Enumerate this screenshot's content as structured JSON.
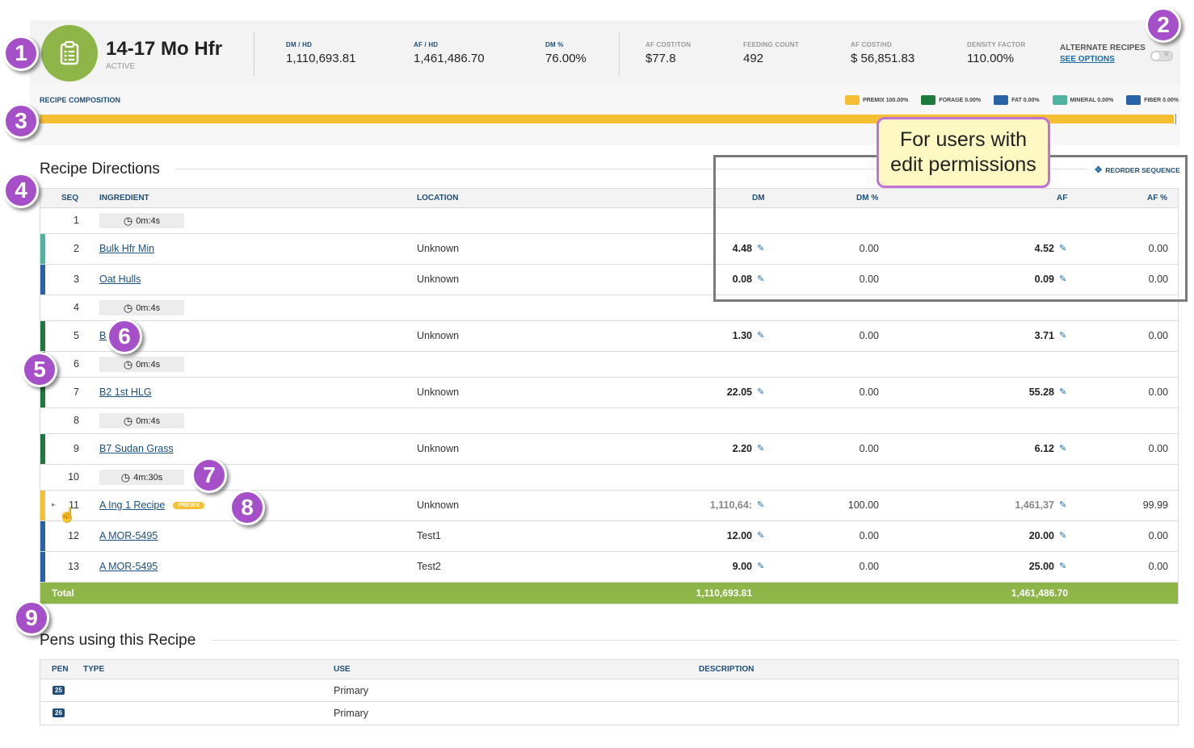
{
  "header": {
    "name": "14-17 Mo Hfr",
    "status": "ACTIVE",
    "stats": [
      {
        "label": "DM / HD",
        "value": "1,110,693.81"
      },
      {
        "label": "AF / HD",
        "value": "1,461,486.70"
      },
      {
        "label": "DM %",
        "value": "76.00%"
      },
      {
        "label": "AF COST/TON",
        "value": "$77.8"
      },
      {
        "label": "FEEDING COUNT",
        "value": "492"
      },
      {
        "label": "AF COST/HD",
        "value": "$ 56,851.83"
      },
      {
        "label": "DENSITY FACTOR",
        "value": "110.00%"
      }
    ],
    "alternate_label": "ALTERNATE RECIPES",
    "see_options": "SEE OPTIONS",
    "toggle_text": "N",
    "toggle_on": false
  },
  "composition": {
    "title": "RECIPE COMPOSITION",
    "legend": [
      {
        "label": "PREMIX 100.00%",
        "color": "#f5bf33"
      },
      {
        "label": "FORAGE 0.00%",
        "color": "#1d7a3c"
      },
      {
        "label": "FAT 0.00%",
        "color": "#2a62a8"
      },
      {
        "label": "MINERAL 0.00%",
        "color": "#4fb3a0"
      },
      {
        "label": "FIBER 0.00%",
        "color": "#2a62a8"
      }
    ],
    "premix_fraction": 1.0
  },
  "directions": {
    "title": "Recipe Directions",
    "reorder": "REORDER SEQUENCE",
    "columns": {
      "seq": "SEQ",
      "ingredient": "INGREDIENT",
      "location": "LOCATION",
      "dm": "DM",
      "dm_pct": "DM %",
      "af": "AF",
      "af_pct": "AF %"
    },
    "rows": [
      {
        "seq": "1",
        "timer": "0m:4s"
      },
      {
        "seq": "2",
        "ingredient": "Bulk Hfr Min",
        "location": "Unknown",
        "dm": "4.48",
        "dm_pct": "0.00",
        "af": "4.52",
        "af_pct": "0.00"
      },
      {
        "seq": "3",
        "ingredient": "Oat Hulls",
        "location": "Unknown",
        "dm": "0.08",
        "dm_pct": "0.00",
        "af": "0.09",
        "af_pct": "0.00"
      },
      {
        "seq": "4",
        "timer": "0m:4s"
      },
      {
        "seq": "5",
        "ingredient": "B(",
        "location": "Unknown",
        "dm": "1.30",
        "dm_pct": "0.00",
        "af": "3.71",
        "af_pct": "0.00"
      },
      {
        "seq": "6",
        "timer": "0m:4s"
      },
      {
        "seq": "7",
        "ingredient": "B2 1st HLG",
        "location": "Unknown",
        "dm": "22.05",
        "dm_pct": "0.00",
        "af": "55.28",
        "af_pct": "0.00"
      },
      {
        "seq": "8",
        "timer": "0m:4s"
      },
      {
        "seq": "9",
        "ingredient": "B7 Sudan Grass",
        "location": "Unknown",
        "dm": "2.20",
        "dm_pct": "0.00",
        "af": "6.12",
        "af_pct": "0.00"
      },
      {
        "seq": "10",
        "timer": "4m:30s"
      },
      {
        "seq": "11",
        "ingredient": "A Ing 1 Recipe",
        "badge": "PREMIX",
        "location": "Unknown",
        "dm": "1,110,64:",
        "dm_pct": "100.00",
        "af": "1,461,37",
        "af_pct": "99.99"
      },
      {
        "seq": "12",
        "ingredient": "A MOR-5495",
        "location": "Test1",
        "dm": "12.00",
        "dm_pct": "0.00",
        "af": "20.00",
        "af_pct": "0.00"
      },
      {
        "seq": "13",
        "ingredient": "A MOR-5495",
        "location": "Test2",
        "dm": "9.00",
        "dm_pct": "0.00",
        "af": "25.00",
        "af_pct": "0.00"
      }
    ],
    "total": {
      "label": "Total",
      "dm": "1,110,693.81",
      "af": "1,461,486.70"
    }
  },
  "pens": {
    "title": "Pens using this Recipe",
    "columns": {
      "pen": "PEN",
      "type": "TYPE",
      "use": "USE",
      "description": "DESCRIPTION"
    },
    "rows": [
      {
        "pen": "25",
        "type": "",
        "use": "Primary",
        "description": ""
      },
      {
        "pen": "26",
        "type": "",
        "use": "Primary",
        "description": ""
      }
    ]
  },
  "callouts": {
    "edit_note": [
      "For users with",
      "edit permissions"
    ],
    "numbers": [
      "1",
      "2",
      "3",
      "4",
      "5",
      "6",
      "7",
      "8",
      "9"
    ]
  },
  "colors": {
    "accent_green": "#8db548",
    "premix": "#f5bf33",
    "forage": "#1d7a3c",
    "fat": "#2a62a8",
    "mineral": "#4fb3a0",
    "link": "#1a4f82",
    "callout": "#a54fc8"
  }
}
